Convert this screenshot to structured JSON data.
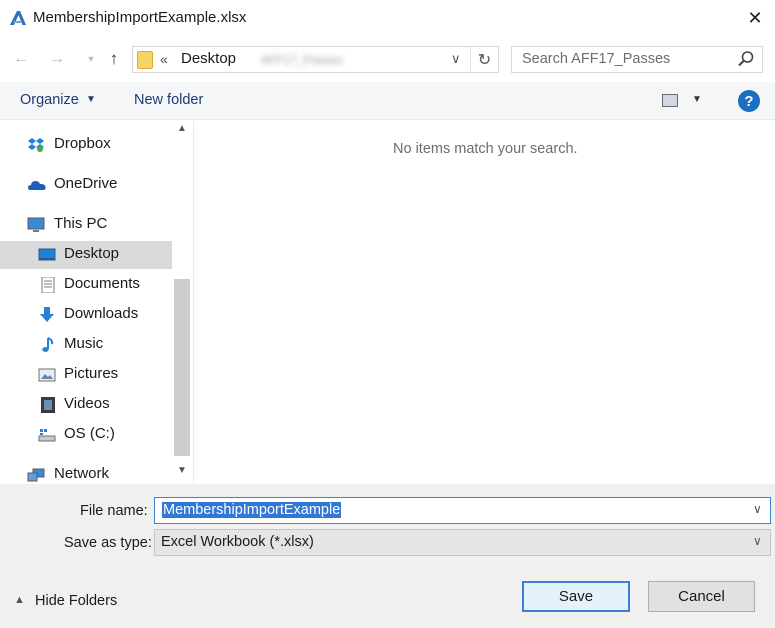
{
  "window": {
    "title": "MembershipImportExample.xlsx",
    "close_glyph": "✕"
  },
  "address": {
    "breadcrumb_chevrons": "«",
    "crumbs": [
      "Desktop",
      "AFF17_Passes"
    ],
    "search_placeholder": "Search AFF17_Passes"
  },
  "toolbar": {
    "organize_label": "Organize",
    "new_folder_label": "New folder",
    "help_glyph": "?"
  },
  "nav": {
    "items": [
      {
        "label": "Dropbox",
        "icon": "dropbox-icon"
      },
      {
        "label": "OneDrive",
        "icon": "onedrive-icon"
      },
      {
        "label": "This PC",
        "icon": "computer-icon"
      },
      {
        "label": "Desktop",
        "icon": "desktop-icon",
        "selected": true
      },
      {
        "label": "Documents",
        "icon": "documents-icon"
      },
      {
        "label": "Downloads",
        "icon": "downloads-icon"
      },
      {
        "label": "Music",
        "icon": "music-icon"
      },
      {
        "label": "Pictures",
        "icon": "pictures-icon"
      },
      {
        "label": "Videos",
        "icon": "videos-icon"
      },
      {
        "label": "OS (C:)",
        "icon": "drive-icon"
      },
      {
        "label": "Network",
        "icon": "network-icon"
      }
    ]
  },
  "content": {
    "empty_message": "No items match your search."
  },
  "form": {
    "filename_label": "File name:",
    "filename_value": "MembershipImportExample",
    "savetype_label": "Save as type:",
    "savetype_value": "Excel Workbook (*.xlsx)"
  },
  "footer": {
    "hide_folders_label": "Hide Folders",
    "save_label": "Save",
    "cancel_label": "Cancel"
  },
  "colors": {
    "accent": "#3078d6",
    "help": "#1b6ec2",
    "toolbar_text": "#1e3d73",
    "selected_bg": "#dadada"
  }
}
